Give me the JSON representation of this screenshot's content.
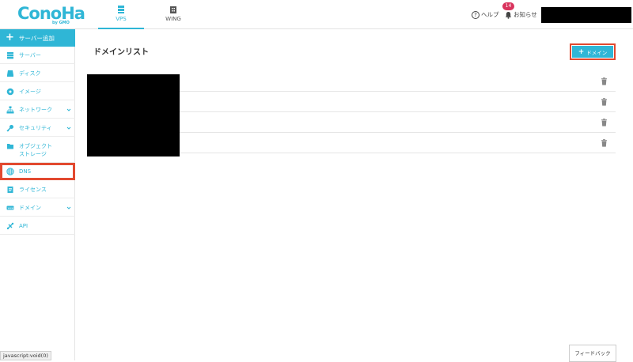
{
  "header": {
    "logo_text": "ConoHa",
    "logo_sub": "by GMO",
    "tabs": [
      {
        "label": "VPS",
        "active": true,
        "icon": "server-icon"
      },
      {
        "label": "WING",
        "active": false,
        "icon": "building-icon"
      }
    ],
    "help_label": "ヘルプ",
    "notice_label": "お知らせ",
    "notice_count": "14"
  },
  "sidebar": {
    "add_label": "サーバー追加",
    "items": [
      {
        "label": "サーバー",
        "icon": "server-icon"
      },
      {
        "label": "ディスク",
        "icon": "disk-icon"
      },
      {
        "label": "イメージ",
        "icon": "image-icon"
      },
      {
        "label": "ネットワーク",
        "icon": "network-icon",
        "expandable": true
      },
      {
        "label": "セキュリティ",
        "icon": "key-icon",
        "expandable": true
      },
      {
        "label_line1": "オブジェクト",
        "label_line2": "ストレージ",
        "icon": "folder-icon"
      },
      {
        "label": "DNS",
        "icon": "globe-icon",
        "highlighted": true
      },
      {
        "label": "ライセンス",
        "icon": "license-icon"
      },
      {
        "label": "ドメイン",
        "icon": "domain-icon",
        "expandable": true
      },
      {
        "label": "API",
        "icon": "api-icon"
      }
    ]
  },
  "main": {
    "title": "ドメインリスト",
    "add_domain_label": "ドメイン",
    "rows": 4,
    "feedback_label": "フィードバック"
  },
  "status_bar": "javascript:void(0)",
  "colors": {
    "accent": "#2fb6d6",
    "highlight": "#e2492f",
    "badge": "#d9345d"
  }
}
